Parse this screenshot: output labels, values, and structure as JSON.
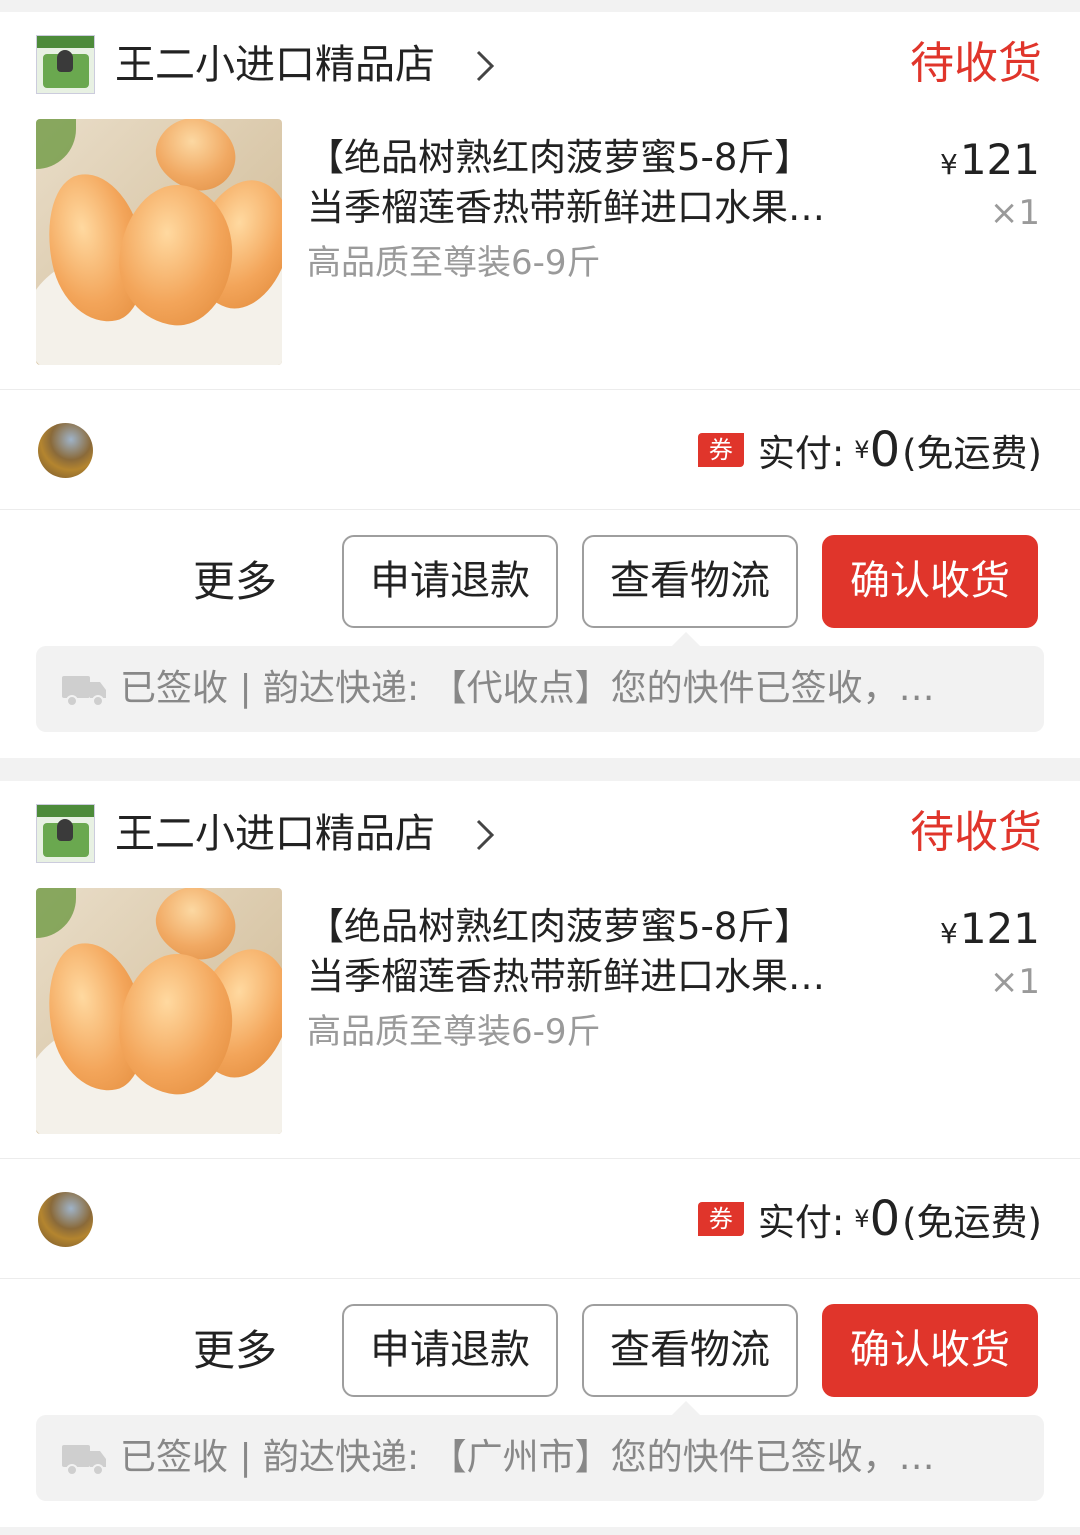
{
  "orders": [
    {
      "shop": {
        "name": "王二小进口精品店",
        "logo_icon": "shop-logo-icon"
      },
      "status": "待收货",
      "product": {
        "title_line1": "【绝品树熟红肉菠萝蜜5-8斤】",
        "title_line2": "当季榴莲香热带新鲜进口水果…",
        "spec": "高品质至尊装6-9斤",
        "price_yen": "¥",
        "price": "121",
        "quantity": "×1"
      },
      "payment": {
        "coupon_badge": "券",
        "label": "实付:",
        "yen": "¥",
        "amount": "0",
        "shipping": "(免运费)"
      },
      "actions": {
        "more": "更多",
        "refund": "申请退款",
        "logistics": "查看物流",
        "confirm": "确认收货"
      },
      "tracking": {
        "text": "已签收 | 韵达快递:  【代收点】您的快件已签收，…"
      }
    },
    {
      "shop": {
        "name": "王二小进口精品店",
        "logo_icon": "shop-logo-icon"
      },
      "status": "待收货",
      "product": {
        "title_line1": "【绝品树熟红肉菠萝蜜5-8斤】",
        "title_line2": "当季榴莲香热带新鲜进口水果…",
        "spec": "高品质至尊装6-9斤",
        "price_yen": "¥",
        "price": "121",
        "quantity": "×1"
      },
      "payment": {
        "coupon_badge": "券",
        "label": "实付:",
        "yen": "¥",
        "amount": "0",
        "shipping": "(免运费)"
      },
      "actions": {
        "more": "更多",
        "refund": "申请退款",
        "logistics": "查看物流",
        "confirm": "确认收货"
      },
      "tracking": {
        "text": "已签收 | 韵达快递:  【广州市】您的快件已签收，…"
      }
    }
  ],
  "colors": {
    "accent": "#e0352b",
    "muted_text": "#9a9a9a",
    "page_background": "#f2f2f2"
  }
}
